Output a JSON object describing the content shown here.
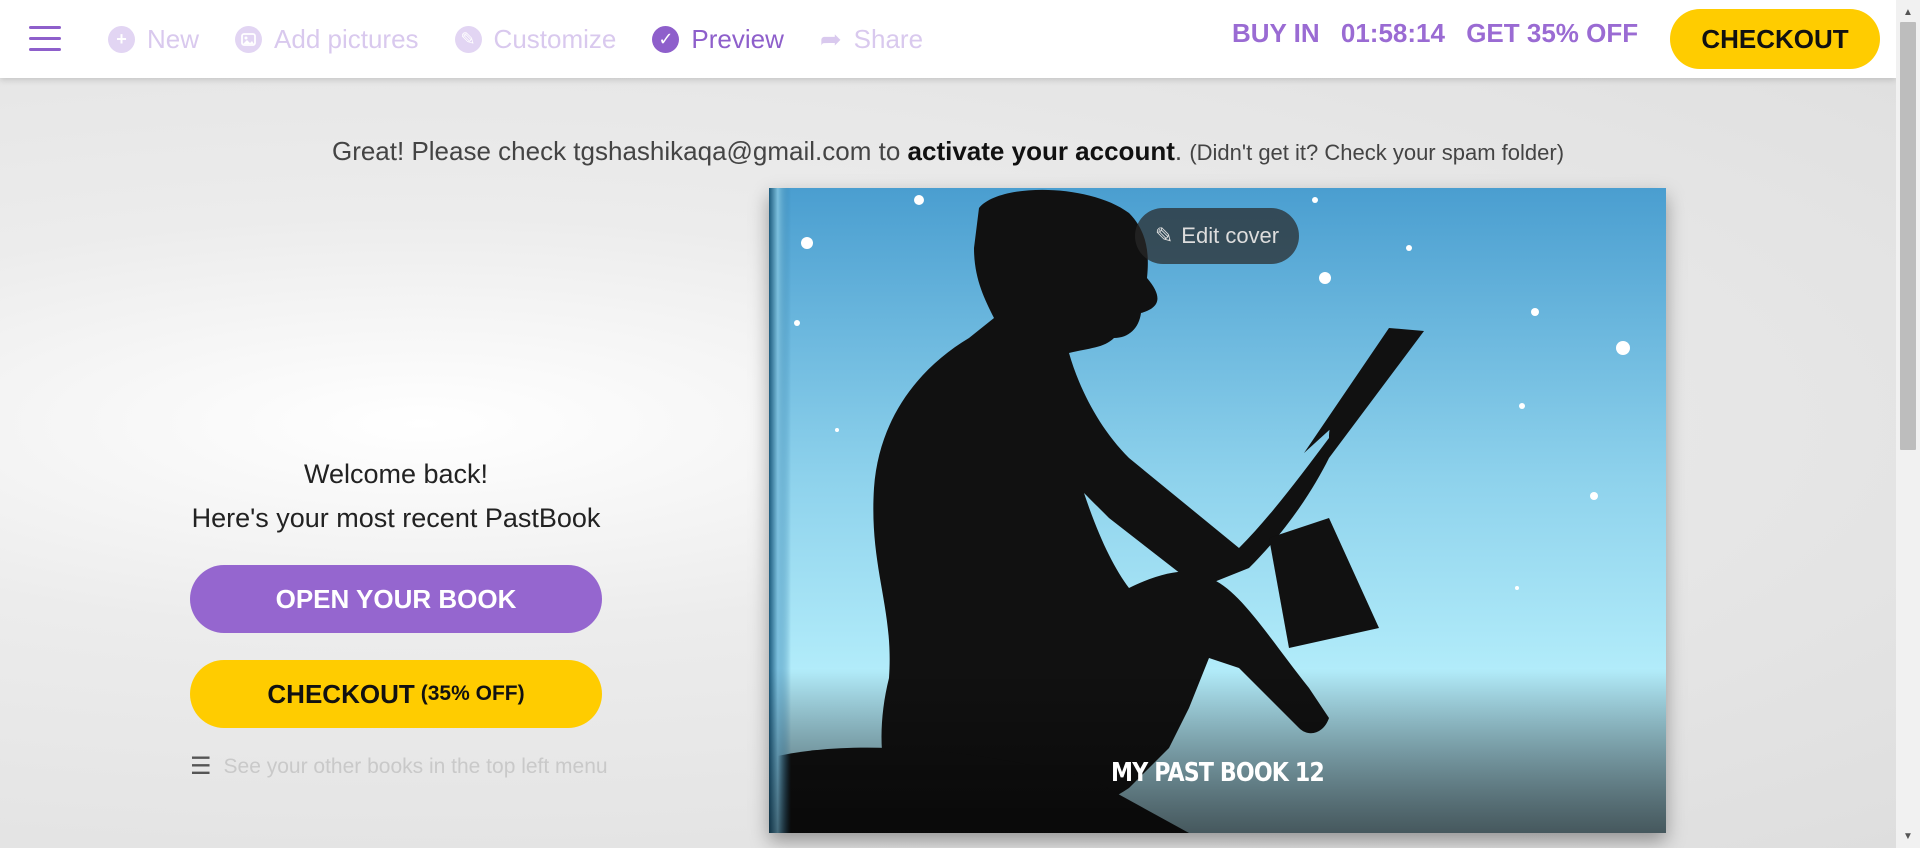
{
  "nav": {
    "steps": [
      {
        "label": "New",
        "icon": "plus-circle-icon",
        "active": false
      },
      {
        "label": "Add pictures",
        "icon": "image-icon",
        "active": false
      },
      {
        "label": "Customize",
        "icon": "pencil-circle-icon",
        "active": false
      },
      {
        "label": "Preview",
        "icon": "check-circle-icon",
        "active": true
      },
      {
        "label": "Share",
        "icon": "share-arrow-icon",
        "active": false
      }
    ],
    "promo": {
      "buy_in": "BUY IN",
      "timer": "01:58:14",
      "offer": "GET 35% OFF"
    },
    "checkout_label": "CHECKOUT"
  },
  "notice": {
    "prefix": "Great! Please check tgshashikaqa@gmail.com to",
    "bold": "activate your account",
    "suffix": ".",
    "small": "(Didn't get it? Check your spam folder)"
  },
  "welcome": {
    "line1": "Welcome back!",
    "line2": "Here's your most recent PastBook"
  },
  "buttons": {
    "open_book": "OPEN YOUR BOOK",
    "checkout": "CHECKOUT",
    "checkout_sub": "(35% OFF)"
  },
  "hint": "See your other books in the top left menu",
  "book": {
    "edit_cover": "Edit cover",
    "title": "MY PAST BOOK 12"
  },
  "colors": {
    "accent_purple": "#9566cf",
    "accent_yellow": "#ffcc00"
  }
}
